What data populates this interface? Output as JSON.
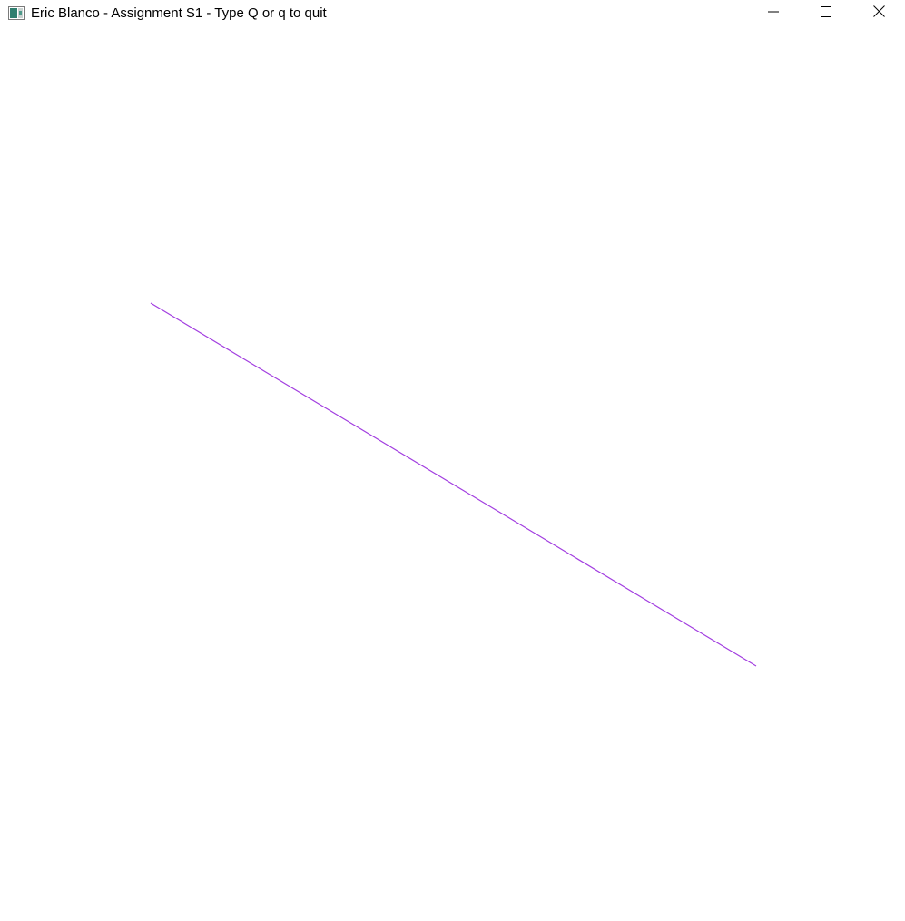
{
  "window": {
    "title": "Eric Blanco - Assignment S1 - Type Q or q to quit",
    "icon": "opengl-window-icon",
    "controls": {
      "minimize": "minimize-icon",
      "maximize": "maximize-icon",
      "close": "close-icon"
    }
  },
  "canvas": {
    "background": "#ffffff",
    "line_color": "#a23ee0",
    "line_icon": "diagonal-line"
  }
}
